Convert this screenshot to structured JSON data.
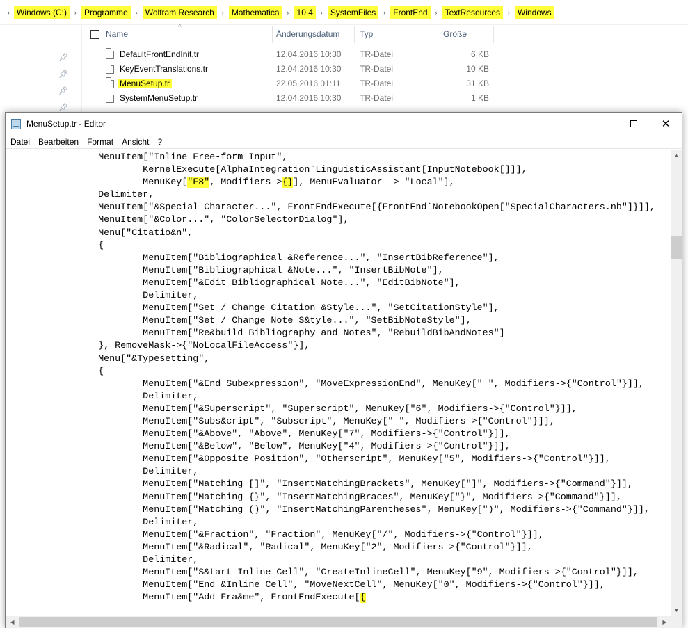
{
  "explorer": {
    "breadcrumb": [
      "Windows (C:)",
      "Programme",
      "Wolfram Research",
      "Mathematica",
      "10.4",
      "SystemFiles",
      "FrontEnd",
      "TextResources",
      "Windows"
    ],
    "columns": {
      "name": "Name",
      "date": "Änderungsdatum",
      "type": "Typ",
      "size": "Größe"
    },
    "files": [
      {
        "name": "DefaultFrontEndInit.tr",
        "date": "12.04.2016 10:30",
        "type": "TR-Datei",
        "size": "6 KB",
        "highlighted": false
      },
      {
        "name": "KeyEventTranslations.tr",
        "date": "12.04.2016 10:30",
        "type": "TR-Datei",
        "size": "10 KB",
        "highlighted": false
      },
      {
        "name": "MenuSetup.tr",
        "date": "22.05.2016 01:11",
        "type": "TR-Datei",
        "size": "31 KB",
        "highlighted": true
      },
      {
        "name": "SystemMenuSetup.tr",
        "date": "12.04.2016 10:30",
        "type": "TR-Datei",
        "size": "1 KB",
        "highlighted": false
      }
    ],
    "highlight_color": "#ffff3a"
  },
  "notepad": {
    "title": "MenuSetup.tr - Editor",
    "menu": [
      "Datei",
      "Bearbeiten",
      "Format",
      "Ansicht",
      "?"
    ],
    "lines": [
      "                MenuItem[\"Inline Free-form Input\",",
      "                        KernelExecute[AlphaIntegration`LinguisticAssistant[InputNotebook[]]],",
      "                        MenuKey[\"F8\", Modifiers->{}], MenuEvaluator -> \"Local\"],",
      "                Delimiter,",
      "                MenuItem[\"&Special Character...\", FrontEndExecute[{FrontEnd`NotebookOpen[\"SpecialCharacters.nb\"]}]],",
      "                MenuItem[\"&Color...\", \"ColorSelectorDialog\"],",
      "                Menu[\"Citatio&n\",",
      "                {",
      "                        MenuItem[\"Bibliographical &Reference...\", \"InsertBibReference\"],",
      "                        MenuItem[\"Bibliographical &Note...\", \"InsertBibNote\"],",
      "                        MenuItem[\"&Edit Bibliographical Note...\", \"EditBibNote\"],",
      "                        Delimiter,",
      "                        MenuItem[\"Set / Change Citation &Style...\", \"SetCitationStyle\"],",
      "                        MenuItem[\"Set / Change Note S&tyle...\", \"SetBibNoteStyle\"],",
      "                        MenuItem[\"Re&build Bibliography and Notes\", \"RebuildBibAndNotes\"]",
      "                }, RemoveMask->{\"NoLocalFileAccess\"}],",
      "                Menu[\"&Typesetting\",",
      "                {",
      "                        MenuItem[\"&End Subexpression\", \"MoveExpressionEnd\", MenuKey[\" \", Modifiers->{\"Control\"}]],",
      "                        Delimiter,",
      "                        MenuItem[\"&Superscript\", \"Superscript\", MenuKey[\"6\", Modifiers->{\"Control\"}]],",
      "                        MenuItem[\"Subs&cript\", \"Subscript\", MenuKey[\"-\", Modifiers->{\"Control\"}]],",
      "                        MenuItem[\"&Above\", \"Above\", MenuKey[\"7\", Modifiers->{\"Control\"}]],",
      "                        MenuItem[\"&Below\", \"Below\", MenuKey[\"4\", Modifiers->{\"Control\"}]],",
      "                        MenuItem[\"&Opposite Position\", \"Otherscript\", MenuKey[\"5\", Modifiers->{\"Control\"}]],",
      "                        Delimiter,",
      "                        MenuItem[\"Matching []\", \"InsertMatchingBrackets\", MenuKey[\"]\", Modifiers->{\"Command\"}]],",
      "                        MenuItem[\"Matching {}\", \"InsertMatchingBraces\", MenuKey[\"}\", Modifiers->{\"Command\"}]],",
      "                        MenuItem[\"Matching ()\", \"InsertMatchingParentheses\", MenuKey[\")\", Modifiers->{\"Command\"}]],",
      "                        Delimiter,",
      "                        MenuItem[\"&Fraction\", \"Fraction\", MenuKey[\"/\", Modifiers->{\"Control\"}]],",
      "                        MenuItem[\"&Radical\", \"Radical\", MenuKey[\"2\", Modifiers->{\"Control\"}]],",
      "                        Delimiter,",
      "                        MenuItem[\"S&tart Inline Cell\", \"CreateInlineCell\", MenuKey[\"9\", Modifiers->{\"Control\"}]],",
      "                        MenuItem[\"End &Inline Cell\", \"MoveNextCell\", MenuKey[\"0\", Modifiers->{\"Control\"}]],",
      "                        MenuItem[\"Add Fra&me\", FrontEndExecute[{"
    ],
    "text_highlights": [
      {
        "line": 2,
        "text": "\"F8\""
      },
      {
        "line": 2,
        "text": "{}"
      },
      {
        "line": 35,
        "text": "{"
      }
    ]
  }
}
